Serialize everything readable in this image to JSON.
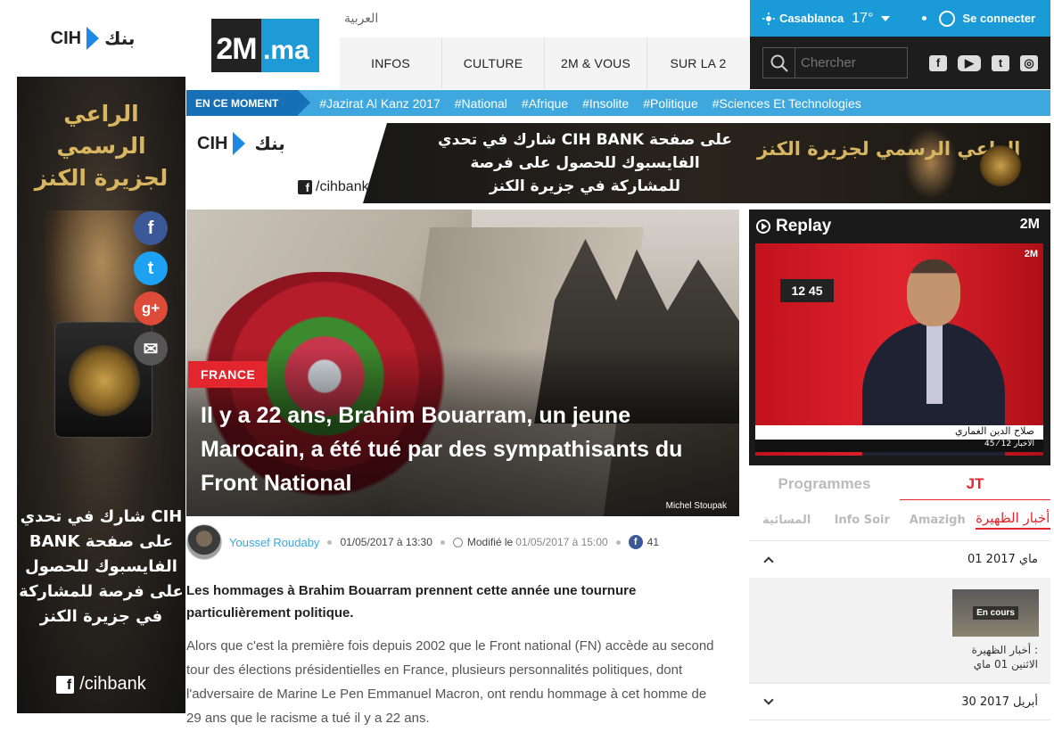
{
  "skin": {
    "logo_cih": "CIH",
    "logo_bank": "بنك",
    "title": "الراعي الرسمي لجزيرة الكنز",
    "message": "شارك في تحدي CIH BANK على صفحة الفايسبوك للحصول على فرصة للمشاركة في جزيرة الكنز",
    "facebook_handle": "/cihbank"
  },
  "share": {
    "facebook": "f",
    "twitter": "t",
    "googleplus": "g+",
    "mail": "✉"
  },
  "header": {
    "logo_main": "2M",
    "logo_suffix": ".ma",
    "lang_link": "العربية",
    "nav": [
      "INFOS",
      "CULTURE",
      "2M & VOUS",
      "SUR LA 2"
    ],
    "city": "Casablanca",
    "temperature": "17°",
    "login": "Se connecter",
    "search_placeholder": "Chercher",
    "social_icons": [
      "facebook-icon",
      "youtube-icon",
      "twitter-icon",
      "instagram-icon"
    ]
  },
  "ticker": {
    "label": "EN CE MOMENT",
    "tags": [
      "#Jazirat Al Kanz 2017",
      "#National",
      "#Afrique",
      "#Insolite",
      "#Politique",
      "#Sciences Et Technologies"
    ]
  },
  "banner": {
    "cih": "CIH",
    "bank": "بنك",
    "facebook_handle": "/cihbank",
    "message": "شارك في تحدي CIH BANK على صفحة الفايسبوك للحصول على فرصة للمشاركة في جزيرة الكنز",
    "title": "الراعي الرسمي لجزيرة الكنز"
  },
  "article": {
    "category": "FRANCE",
    "title": "Il y a 22 ans, Brahim Bouarram, un jeune Marocain, a été tué par des sympathisants du Front National",
    "photo_credit": "Michel Stoupak",
    "author": "Youssef Roudaby",
    "published": "01/05/2017 à 13:30",
    "modified_label": "Modifié le",
    "modified": "01/05/2017 à 15:00",
    "fb_count": "41",
    "lead": "Les hommages à Brahim Bouarram prennent cette année une tournure particulièrement politique.",
    "body": "Alors que c'est la première fois depuis 2002 que le Front national (FN) accède au second tour des élections présidentielles en France, plusieurs personnalités politiques, dont l'adversaire de Marine Le Pen Emmanuel Macron, ont rendu hommage à cet homme de 29 ans que le racisme a tué il y a 22 ans."
  },
  "replay": {
    "title": "Replay",
    "logo": "2M",
    "video_badge": "12 45",
    "lower_third": "صلاح الدين الغماري",
    "lower_ticker": "45 ⁄ 12 الأخبار",
    "tabs": [
      "Programmes",
      "JT"
    ],
    "active_tab": "JT",
    "subtabs": [
      "المسائية",
      "Info Soir",
      "Amazigh",
      "أخبار الظهيرة"
    ],
    "active_subtab": "أخبار الظهيرة",
    "dates": [
      "01 ماي 2017",
      "30 أبريل 2017"
    ],
    "video_status": "En cours",
    "video_caption_1": "أخبار الظهيرة :",
    "video_caption_2": "الاثنين 01 ماي"
  },
  "colors": {
    "brand_blue": "#1a9ad7",
    "ticker_dark": "#1770b6",
    "accent_red": "#e3262e",
    "dark": "#1d1d1d"
  }
}
